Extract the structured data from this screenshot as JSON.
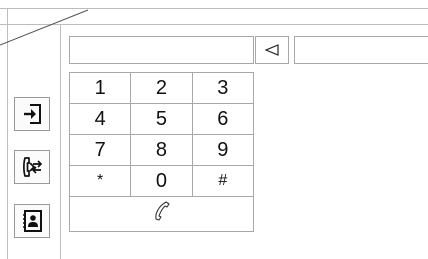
{
  "dialer": {
    "number_value": "",
    "keys": [
      [
        "1",
        "2",
        "3"
      ],
      [
        "4",
        "5",
        "6"
      ],
      [
        "7",
        "8",
        "9"
      ],
      [
        "*",
        "0",
        "#"
      ]
    ]
  },
  "icons": {
    "side_1": "login-icon",
    "side_2": "call-transfer-icon",
    "side_3": "contacts-icon",
    "backspace": "backspace-icon",
    "call": "phone-handset-icon"
  }
}
